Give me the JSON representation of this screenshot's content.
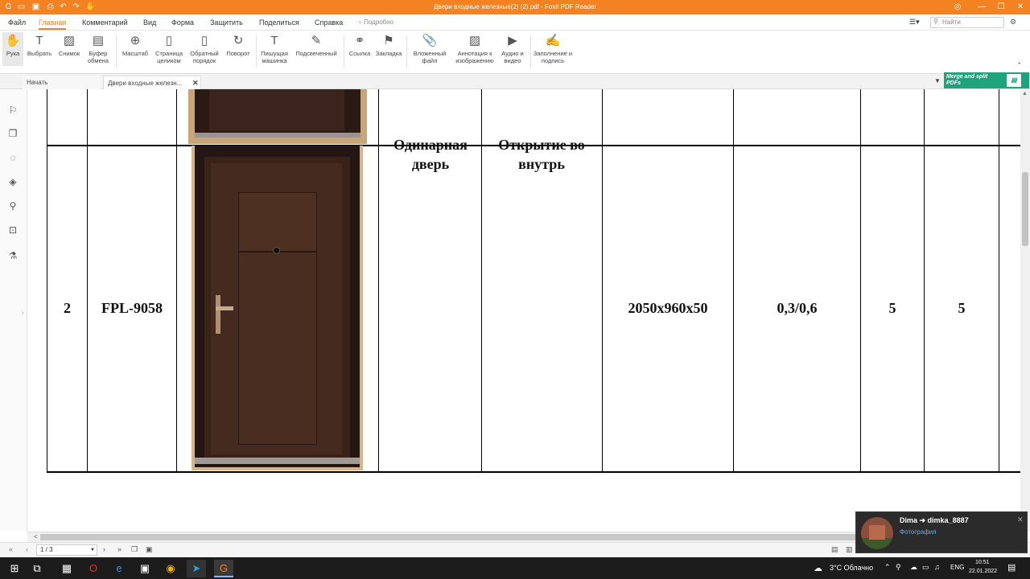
{
  "app": {
    "title": "Двери входные железные(2) (2).pdf - Foxit PDF Reader"
  },
  "menu": {
    "items": [
      "Файл",
      "Главная",
      "Комментарий",
      "Вид",
      "Форма",
      "Защитить",
      "Поделиться",
      "Справка"
    ],
    "active": "Главная",
    "tell_me": "Подробно",
    "search_placeholder": "Найти"
  },
  "ribbon": {
    "tools": [
      {
        "label": "Рука",
        "icon": "hand-icon"
      },
      {
        "label": "Выбрать",
        "icon": "select-text-icon"
      },
      {
        "label": "Снимок",
        "icon": "snapshot-icon"
      },
      {
        "label": "Буфер обмена",
        "icon": "clipboard-icon"
      },
      {
        "label": "Масштаб",
        "icon": "zoom-icon"
      },
      {
        "label": "Страница целиком",
        "icon": "fit-page-icon"
      },
      {
        "label": "Обратный порядок",
        "icon": "reverse-order-icon"
      },
      {
        "label": "Поворот",
        "icon": "rotate-icon"
      },
      {
        "label": "Пишущая машинка",
        "icon": "typewriter-icon"
      },
      {
        "label": "Подсвеченный",
        "icon": "highlight-icon"
      },
      {
        "label": "Ссылка",
        "icon": "link-icon"
      },
      {
        "label": "Закладка",
        "icon": "bookmark-icon"
      },
      {
        "label": "Вложенный файл",
        "icon": "attachment-file-icon"
      },
      {
        "label": "Аннотация к изображению",
        "icon": "image-annotation-icon"
      },
      {
        "label": "Аудио и видео",
        "icon": "audio-video-icon"
      },
      {
        "label": "Заполнение и подпись",
        "icon": "fill-sign-icon"
      }
    ]
  },
  "tabs": [
    {
      "label": "Начать"
    },
    {
      "label": "Двери входные железн..."
    }
  ],
  "promo": {
    "text": "Merge and split PDFs"
  },
  "document": {
    "row": {
      "number": "2",
      "model": "FPL-9058",
      "type": "Одинарная дверь",
      "opening": "Открытие во внутрь",
      "size": "2050x960x50",
      "thickness": "0,3/0,6",
      "qty_a": "5",
      "qty_b": "5"
    }
  },
  "statusbar": {
    "page": "1 / 3"
  },
  "notification": {
    "title": "Dima ➜ dimka_8887",
    "subtitle": "Фотография"
  },
  "taskbar": {
    "weather": "3°C  Облачно",
    "lang": "ENG",
    "time": "10:51",
    "date": "22.01.2022"
  }
}
